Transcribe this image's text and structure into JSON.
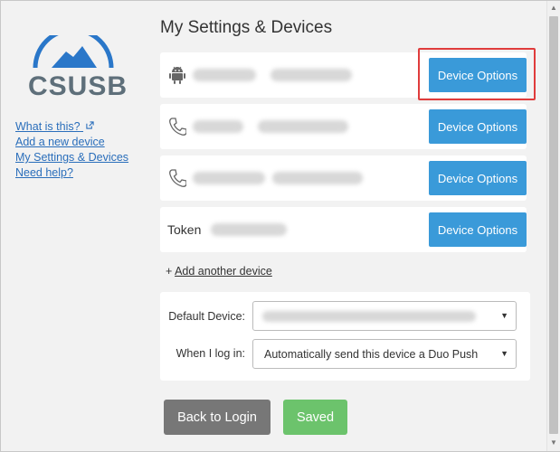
{
  "sidebar": {
    "logo_text": "CSUSB",
    "links": [
      {
        "label": "What is this?"
      },
      {
        "label": "Add a new device"
      },
      {
        "label": "My Settings & Devices"
      },
      {
        "label": "Need help?"
      }
    ]
  },
  "main": {
    "title": "My Settings & Devices",
    "devices": [
      {
        "type": "android",
        "button_label": "Device Options"
      },
      {
        "type": "phone",
        "button_label": "Device Options"
      },
      {
        "type": "phone",
        "button_label": "Device Options"
      },
      {
        "type": "token",
        "label": "Token",
        "button_label": "Device Options"
      }
    ],
    "add_device": {
      "prefix": "+ ",
      "link_label": "Add another device"
    },
    "settings": {
      "default_device_label": "Default Device:",
      "default_device_value": "",
      "login_label": "When I log in:",
      "login_value": "Automatically send this device a Duo Push"
    },
    "back_button_label": "Back to Login",
    "saved_button_label": "Saved"
  },
  "colors": {
    "primary_button": "#3a9ad9",
    "back_button": "#777777",
    "saved_button": "#6cc36c",
    "highlight": "#e03c3c",
    "link": "#2a6ebb"
  },
  "icons": {
    "row1": "android-icon",
    "row2": "phone-icon",
    "row3": "phone-icon",
    "external": "external-link-icon"
  }
}
